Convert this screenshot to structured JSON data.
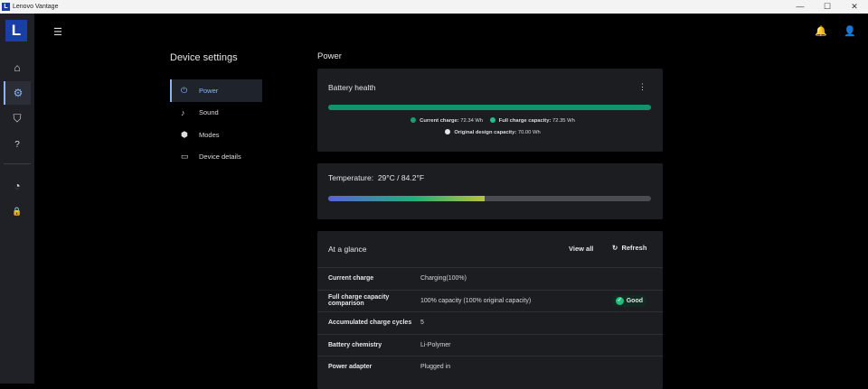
{
  "window": {
    "title": "Lenovo Vantage",
    "logo": "L",
    "controls": [
      "—",
      "☐",
      "✕"
    ]
  },
  "rail": {
    "logo": "L",
    "items": [
      {
        "icon": "home-icon",
        "glyph": "⌂"
      },
      {
        "icon": "gear-icon",
        "glyph": "⚙",
        "active": true
      },
      {
        "icon": "shield-icon",
        "glyph": "⛉"
      },
      {
        "icon": "help-icon",
        "glyph": "?"
      },
      {
        "icon": "gauge-icon",
        "glyph": "◔"
      },
      {
        "icon": "lock-icon",
        "glyph": "🔒"
      }
    ]
  },
  "header": {
    "collapse_glyph": "☰",
    "bell_glyph": "🔔",
    "user_glyph": "👤"
  },
  "settings": {
    "title": "Device settings",
    "nav": [
      {
        "label": "Power",
        "glyph": "⏻",
        "active": true
      },
      {
        "label": "Sound",
        "glyph": "♪"
      },
      {
        "label": "Modes",
        "glyph": "⬢"
      },
      {
        "label": "Device details",
        "glyph": "▭"
      }
    ]
  },
  "page": {
    "title": "Power"
  },
  "battery": {
    "title": "Battery health",
    "menu": "⋮",
    "health_fraction": 1.0,
    "legend": [
      {
        "label": "Current charge:",
        "value": "72.34 Wh",
        "color": "#1a9e6e"
      },
      {
        "label": "Full charge capacity:",
        "value": "72.35 Wh",
        "color": "#1fbf8a"
      },
      {
        "label": "Original design capacity:",
        "value": "70.00 Wh",
        "color": "#e6e6e6"
      }
    ]
  },
  "temperature": {
    "label": "Temperature:",
    "value": "29°C / 84.2°F",
    "fill_fraction": 0.485
  },
  "glance": {
    "title": "At a glance",
    "view_all": "View all",
    "refresh": "Refresh",
    "refresh_glyph": "↻",
    "rows": [
      {
        "key": "Current charge",
        "value": "Charging(100%)"
      },
      {
        "key": "Full charge capacity comparison",
        "value": "100% capacity (100% original capacity)",
        "badge": "Good"
      },
      {
        "key": "Accumulated charge cycles",
        "value": "5"
      },
      {
        "key": "Battery chemistry",
        "value": "Li-Polymer"
      },
      {
        "key": "Power adapter",
        "value": "Plugged in"
      }
    ]
  }
}
